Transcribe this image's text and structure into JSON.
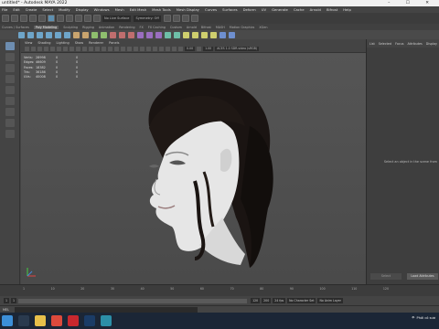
{
  "title_bar": {
    "text": "untitled* - Autodesk MAYA 2022",
    "controls": "– ☐ ✕"
  },
  "menubar": {
    "items": [
      "File",
      "Edit",
      "Create",
      "Select",
      "Modify",
      "Display",
      "Windows",
      "Mesh",
      "Edit Mesh",
      "Mesh Tools",
      "Mesh Display",
      "Curves",
      "Surfaces",
      "Deform",
      "UV",
      "Generate",
      "Cache",
      "Arnold",
      "Bifrost",
      "Help"
    ]
  },
  "status_line": {
    "live_surface": "No Live Surface",
    "symmetry": "Symmetry: Off"
  },
  "shelf_tabs": {
    "items": [
      "Curves / Surfaces",
      "Poly Modeling",
      "Sculpting",
      "Rigging",
      "Animation",
      "Rendering",
      "FX",
      "FX Caching",
      "Custom",
      "Arnold",
      "Bifrost",
      "MASH",
      "Motion Graphics",
      "XGen"
    ],
    "active": "Poly Modeling"
  },
  "panel": {
    "menus": [
      "View",
      "Shading",
      "Lighting",
      "Show",
      "Renderer",
      "Panels"
    ],
    "exposure": "0.00",
    "gamma": "1.00",
    "color_space": "ACES 1.0 SDR-video (sRGB)"
  },
  "hud": {
    "rows": [
      {
        "label": "Verts:",
        "v1": "28998",
        "v2": "0",
        "v3": "0"
      },
      {
        "label": "Edges:",
        "v1": "46609",
        "v2": "0",
        "v3": "0"
      },
      {
        "label": "Faces:",
        "v1": "18382",
        "v2": "0",
        "v3": "0"
      },
      {
        "label": "Tris:",
        "v1": "36186",
        "v2": "0",
        "v3": "0"
      },
      {
        "label": "UVs:",
        "v1": "40008",
        "v2": "0",
        "v3": "0"
      }
    ]
  },
  "channel_box": {
    "tabs": [
      "List",
      "Selected",
      "Focus",
      "Attributes",
      "Display"
    ],
    "empty_message": "Select an object in the scene from",
    "buttons": [
      "Select",
      "Load Attributes"
    ]
  },
  "time_slider": {
    "ticks": [
      "1",
      "10",
      "20",
      "30",
      "40",
      "50",
      "60",
      "70",
      "80",
      "90",
      "100",
      "110",
      "120"
    ]
  },
  "range_slider": {
    "start": "1",
    "end": "120",
    "range_end": "200",
    "fps": "24 fps",
    "character_set": "No Character Set",
    "anim_layer": "No Anim Layer"
  },
  "command_line": {
    "label": "MEL"
  },
  "taskbar": {
    "weather": "Phải có sươ",
    "icons": [
      "windows",
      "search",
      "file-explorer",
      "chrome",
      "opera",
      "photoshop",
      "maya"
    ]
  },
  "colors": {
    "accent": "#5d8fb0",
    "taskbar": "#1b2636",
    "hair": "#1a1412",
    "skin": "#e6e6e6"
  }
}
